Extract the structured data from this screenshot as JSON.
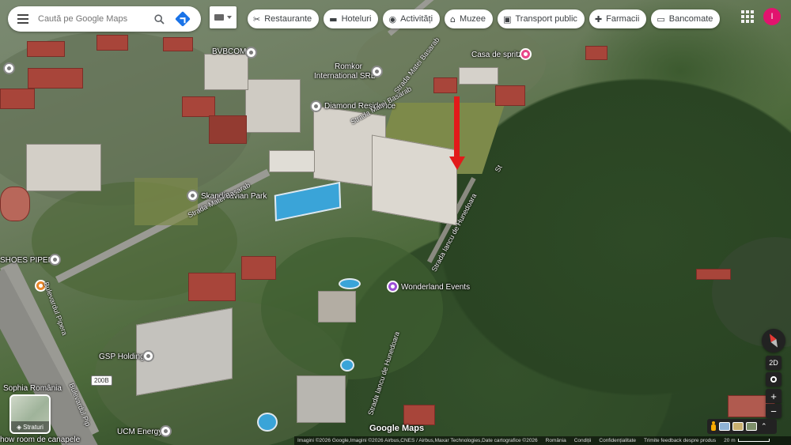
{
  "search": {
    "placeholder": "Caută pe Google Maps"
  },
  "chips": [
    {
      "icon": "✂",
      "label": "Restaurante"
    },
    {
      "icon": "▬",
      "label": "Hoteluri"
    },
    {
      "icon": "◉",
      "label": "Activități"
    },
    {
      "icon": "⌂",
      "label": "Muzee"
    },
    {
      "icon": "▣",
      "label": "Transport public"
    },
    {
      "icon": "✚",
      "label": "Farmacii"
    },
    {
      "icon": "▭",
      "label": "Bancomate"
    }
  ],
  "account": {
    "initial": "I",
    "color": "#e2136e"
  },
  "places": {
    "bvbcom": "BVBCOM",
    "romkor": "Romkor\nInternational SRL",
    "romkor_line1": "Romkor",
    "romkor_line2": "International SRL",
    "diamond": "Diamond Residence",
    "casa": "Casa de spritz",
    "skandinavian": "Skandinavian Park",
    "shoes": "SHOES PIPERA",
    "wonderland": "Wonderland Events",
    "gsp": "GSP Holding",
    "sophia": "Sophia România",
    "ucm": "UCM Energy",
    "canapele": "how room de canapele"
  },
  "streets": {
    "matei_top": "Strada Matei Basarab",
    "basarab_mid": "Strada Matei Basarab",
    "basarab_a": "Strada Matei Basarab",
    "hunedoara_a": "Strada Iancu de Hunedoara",
    "hunedoara_b": "Strada Iancu de Hunedoara",
    "pipera": "Bulevardul Pipera",
    "bd_pipera": "Bulevardul Pip",
    "st": "St"
  },
  "road_badge": "200B",
  "layers": {
    "label": "Straturi",
    "icon": "◈"
  },
  "controls": {
    "two_d": "2D",
    "zoom_in": "+",
    "zoom_out": "−"
  },
  "footer": {
    "imagery": "Imagini ©2026 Google,Imagini ©2026 Airbus,CNES / Airbus,Maxar Technologies,Date cartografice ©2026",
    "romania": "România",
    "terms": "Condiții",
    "privacy": "Confidențialitate",
    "feedback": "Trimite feedback despre produs",
    "scale": "20 m"
  },
  "logo": "Google Maps",
  "accent_red": "#e21a1a"
}
